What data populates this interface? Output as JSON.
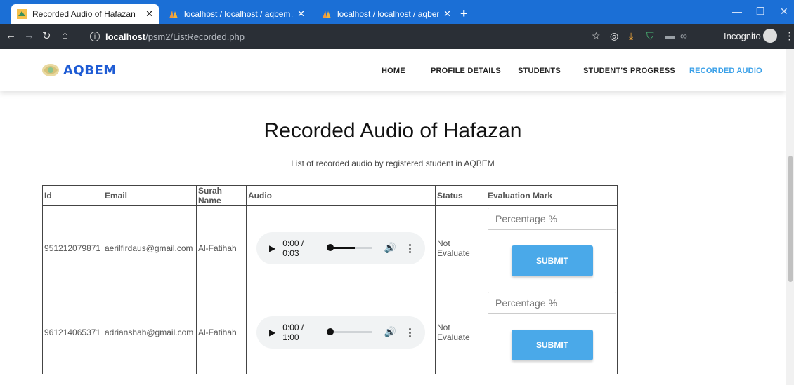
{
  "browser": {
    "tabs": [
      {
        "title": "Recorded Audio of Hafazan",
        "active": true
      },
      {
        "title": "localhost / localhost / aqbem / re",
        "active": false
      },
      {
        "title": "localhost / localhost / aqbem / s",
        "active": false
      }
    ],
    "url_host": "localhost",
    "url_path": "/psm2/ListRecorded.php",
    "incognito_label": "Incognito"
  },
  "nav": {
    "logo_text": "AQBEM",
    "items": [
      "HOME",
      "PROFILE DETAILS",
      "STUDENTS",
      "STUDENT'S PROGRESS",
      "RECORDED AUDIO"
    ],
    "active_item": "RECORDED AUDIO"
  },
  "page": {
    "title": "Recorded Audio of Hafazan",
    "subtitle": "List of recorded audio by registered student in AQBEM"
  },
  "table": {
    "headers": [
      "Id",
      "Email",
      "Surah Name",
      "Audio",
      "Status",
      "Evaluation Mark"
    ],
    "rows": [
      {
        "id": "951212079871",
        "email": "aerilfirdaus@gmail.com",
        "surah": "Al-Fatihah",
        "audio_time": "0:00 / 0:03",
        "status": "Not Evaluate",
        "placeholder": "Percentage %",
        "button": "SUBMIT"
      },
      {
        "id": "961214065371",
        "email": "adrianshah@gmail.com",
        "surah": "Al-Fatihah",
        "audio_time": "0:00 / 1:00",
        "status": "Not Evaluate",
        "placeholder": "Percentage %",
        "button": "SUBMIT"
      }
    ]
  },
  "colors": {
    "accent": "#3aa0e8",
    "button": "#4aa9e9",
    "logo": "#1e5bd4",
    "tabbar": "#1b6fd6"
  }
}
